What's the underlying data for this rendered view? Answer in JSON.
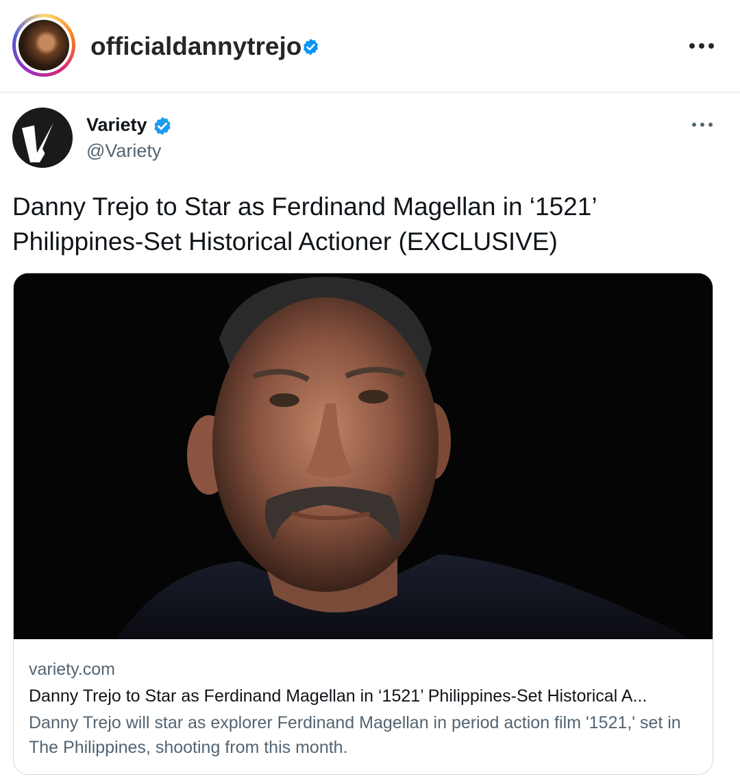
{
  "post": {
    "username": "officialdannytrejo",
    "verified": true,
    "avatar_alt": "profile-photo",
    "more_icon": "more-horizontal-icon"
  },
  "tweet": {
    "name": "Variety",
    "handle": "@Variety",
    "verified": true,
    "text": "Danny Trejo to Star as Ferdinand Magellan in ‘1521’ Philippines-Set Historical Actioner (EXCLUSIVE)",
    "more_icon": "more-horizontal-icon"
  },
  "card": {
    "domain": "variety.com",
    "title": "Danny Trejo to Star as Ferdinand Magellan in ‘1521’ Philippines-Set Historical A...",
    "description": "Danny Trejo will star as explorer Ferdinand Magellan in period action film '1521,' set in The Philippines, shooting from this month."
  },
  "colors": {
    "verified_blue": "#1d9bf0",
    "secondary_text": "#536471",
    "border": "#cfd9de"
  }
}
